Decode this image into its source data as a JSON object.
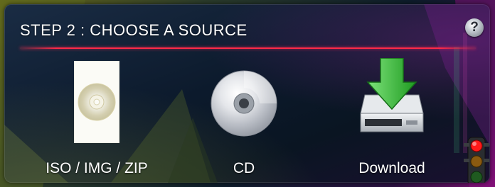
{
  "panel": {
    "title": "STEP 2 : CHOOSE A SOURCE",
    "help_symbol": "?"
  },
  "options": [
    {
      "label": "ISO / IMG / ZIP",
      "icon": "disc-image-file-icon"
    },
    {
      "label": "CD",
      "icon": "cd-disc-icon"
    },
    {
      "label": "Download",
      "icon": "download-drive-icon"
    }
  ],
  "status_light": {
    "icon": "traffic-light-icon",
    "active": "red"
  },
  "colors": {
    "divider": "#ff2a48",
    "download_arrow": "#3cc23a",
    "traffic_red": "#ff1a1a"
  }
}
